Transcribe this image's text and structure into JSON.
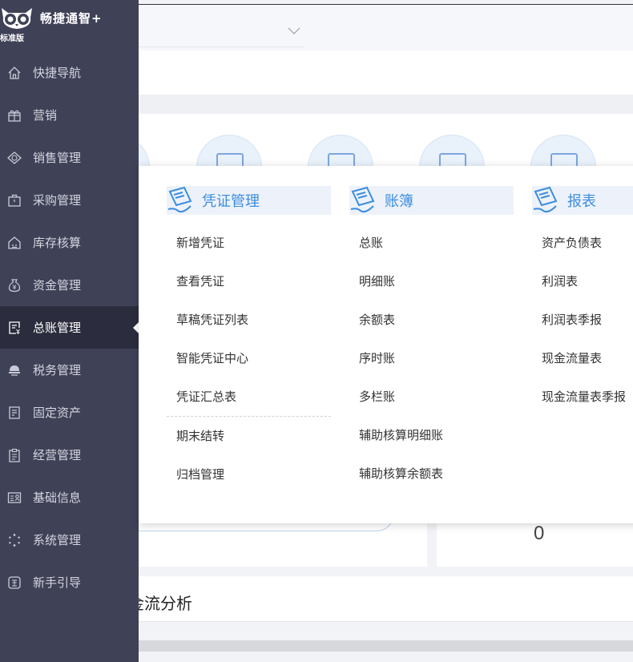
{
  "brand": {
    "name": "畅捷通智+",
    "edition": "标准版"
  },
  "sidebar": {
    "items": [
      {
        "label": "快捷导航",
        "icon": "home-icon"
      },
      {
        "label": "营销",
        "icon": "gift-icon"
      },
      {
        "label": "销售管理",
        "icon": "sales-icon"
      },
      {
        "label": "采购管理",
        "icon": "briefcase-icon"
      },
      {
        "label": "库存核算",
        "icon": "warehouse-icon"
      },
      {
        "label": "资金管理",
        "icon": "money-bag-icon"
      },
      {
        "label": "总账管理",
        "icon": "ledger-icon",
        "active": true
      },
      {
        "label": "税务管理",
        "icon": "tax-icon"
      },
      {
        "label": "固定资产",
        "icon": "asset-icon"
      },
      {
        "label": "经营管理",
        "icon": "clipboard-icon"
      },
      {
        "label": "基础信息",
        "icon": "id-card-icon"
      },
      {
        "label": "系统管理",
        "icon": "spinner-icon"
      },
      {
        "label": "新手引导",
        "icon": "new-badge-icon"
      }
    ]
  },
  "menu": {
    "voucher": {
      "title": "凭证管理",
      "items": [
        "新增凭证",
        "查看凭证",
        "草稿凭证列表",
        "智能凭证中心",
        "凭证汇总表"
      ],
      "items2": [
        "期末结转",
        "归档管理"
      ]
    },
    "books": {
      "title": "账簿",
      "items": [
        "总账",
        "明细账",
        "余额表",
        "序时账",
        "多栏账",
        "辅助核算明细账",
        "辅助核算余额表"
      ]
    },
    "reports": {
      "title": "报表",
      "items": [
        "资产负债表",
        "利润表",
        "利润表季报",
        "现金流量表",
        "现金流量表季报"
      ]
    }
  },
  "main": {
    "value": "0",
    "section_title": "金流分析"
  },
  "colors": {
    "sidebar_bg": "#3f4157",
    "sidebar_active": "#2b2c3d",
    "accent": "#3b8de0"
  }
}
